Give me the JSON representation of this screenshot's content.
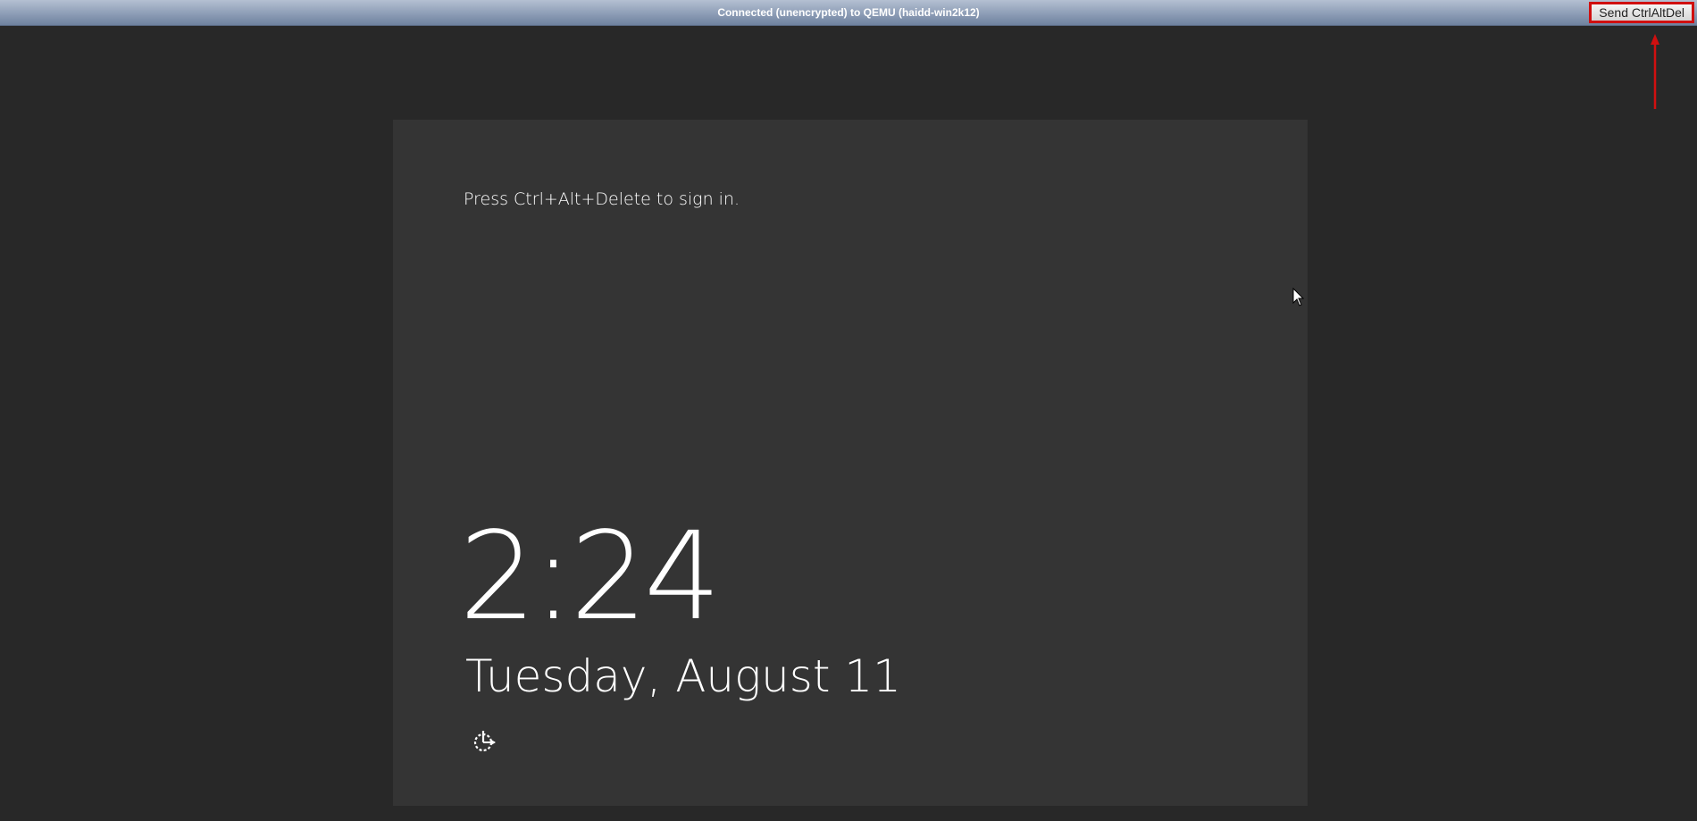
{
  "status_bar": {
    "title": "Connected (unencrypted) to QEMU (haidd-win2k12)",
    "send_cad_label": "Send CtrlAltDel"
  },
  "lock_screen": {
    "prompt": "Press Ctrl+Alt+Delete to sign in.",
    "time": "2:24",
    "date": "Tuesday, August 11",
    "ease_of_access_icon": "ease-of-access-icon"
  },
  "colors": {
    "background": "#282828",
    "screen": "#343434",
    "annotation": "#d01010",
    "text": "#ffffff"
  }
}
